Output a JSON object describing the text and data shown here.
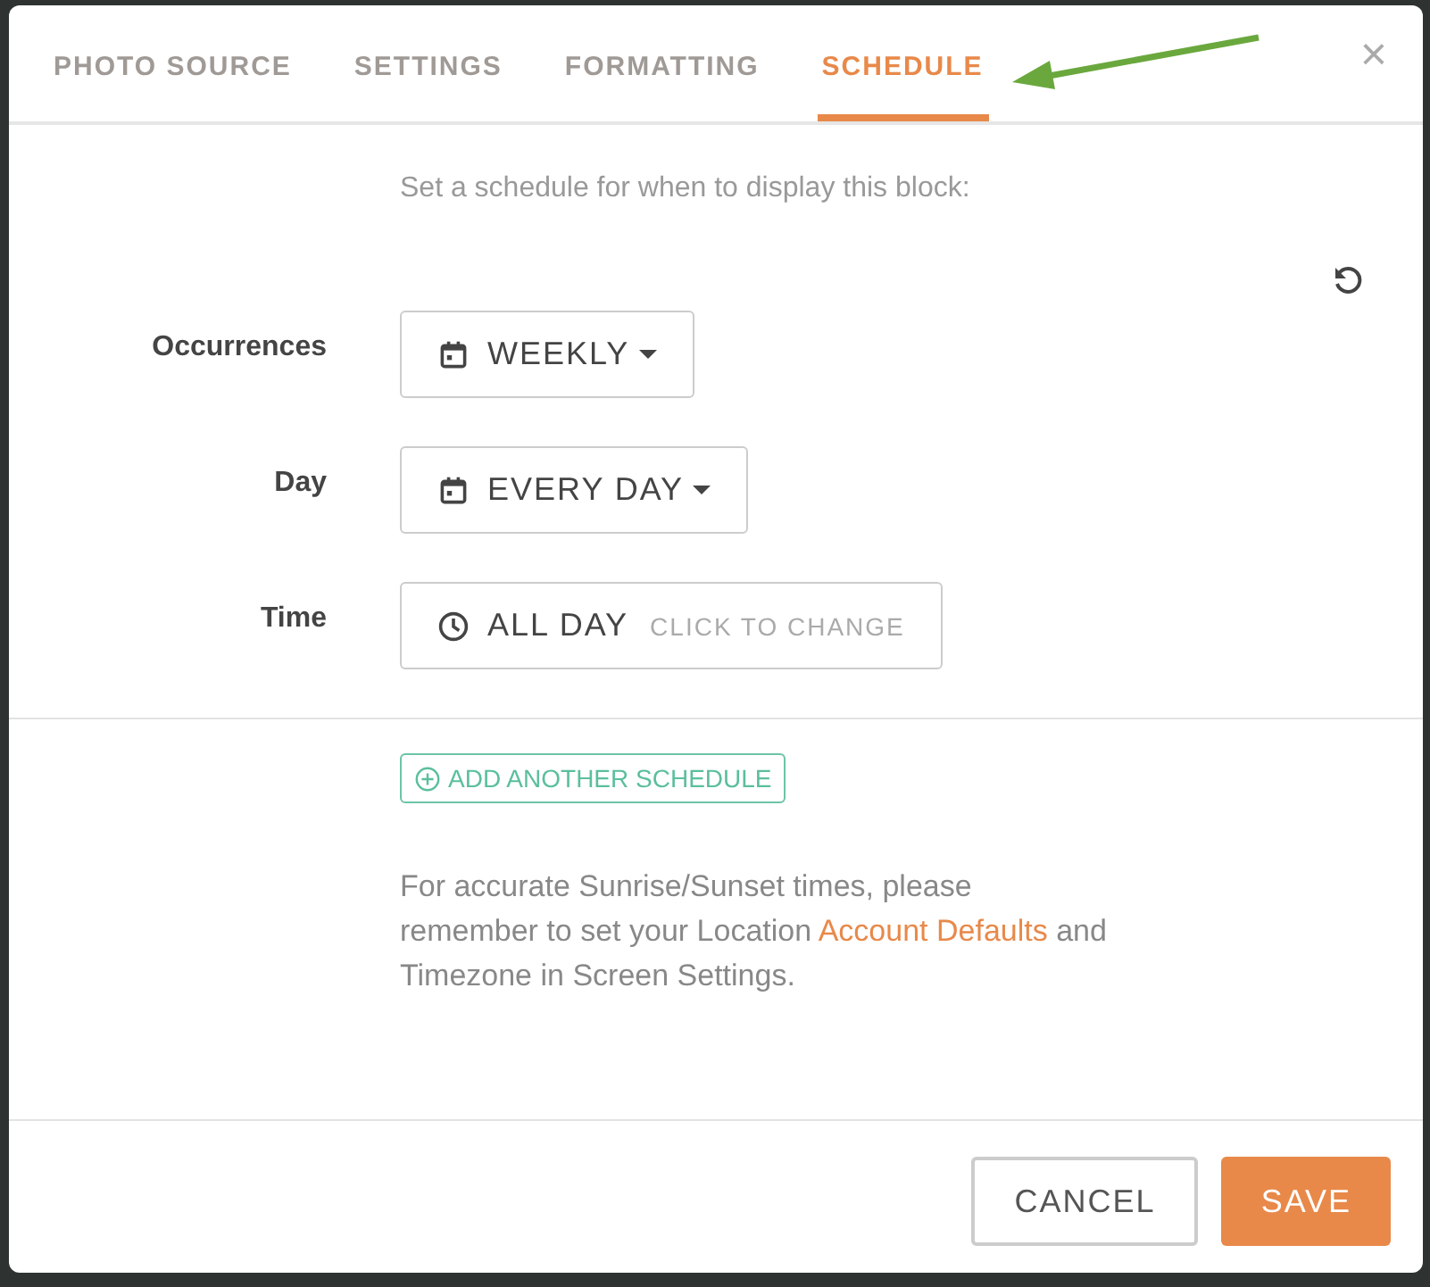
{
  "tabs": [
    {
      "label": "PHOTO SOURCE",
      "selected": false
    },
    {
      "label": "SETTINGS",
      "selected": false
    },
    {
      "label": "FORMATTING",
      "selected": false
    },
    {
      "label": "SCHEDULE",
      "selected": true
    }
  ],
  "close": "×",
  "intro": "Set a schedule for when to display this block:",
  "fields": [
    {
      "label": "Occurrences",
      "kind": "dropdown",
      "value": "WEEKLY"
    },
    {
      "label": "Day",
      "kind": "dropdown",
      "value": "EVERY DAY"
    },
    {
      "label": "Time",
      "kind": "picker",
      "value": "ALL DAY",
      "hint": "CLICK TO CHANGE"
    }
  ],
  "add_button": "ADD ANOTHER SCHEDULE",
  "note": {
    "before": "For accurate Sunrise/Sunset times, please remember to set your Location ",
    "link": "Account Defaults",
    "after": " and Timezone in Screen Settings."
  },
  "buttons": [
    {
      "label": "CANCEL",
      "kind": "secondary"
    },
    {
      "label": "SAVE",
      "kind": "primary"
    }
  ]
}
